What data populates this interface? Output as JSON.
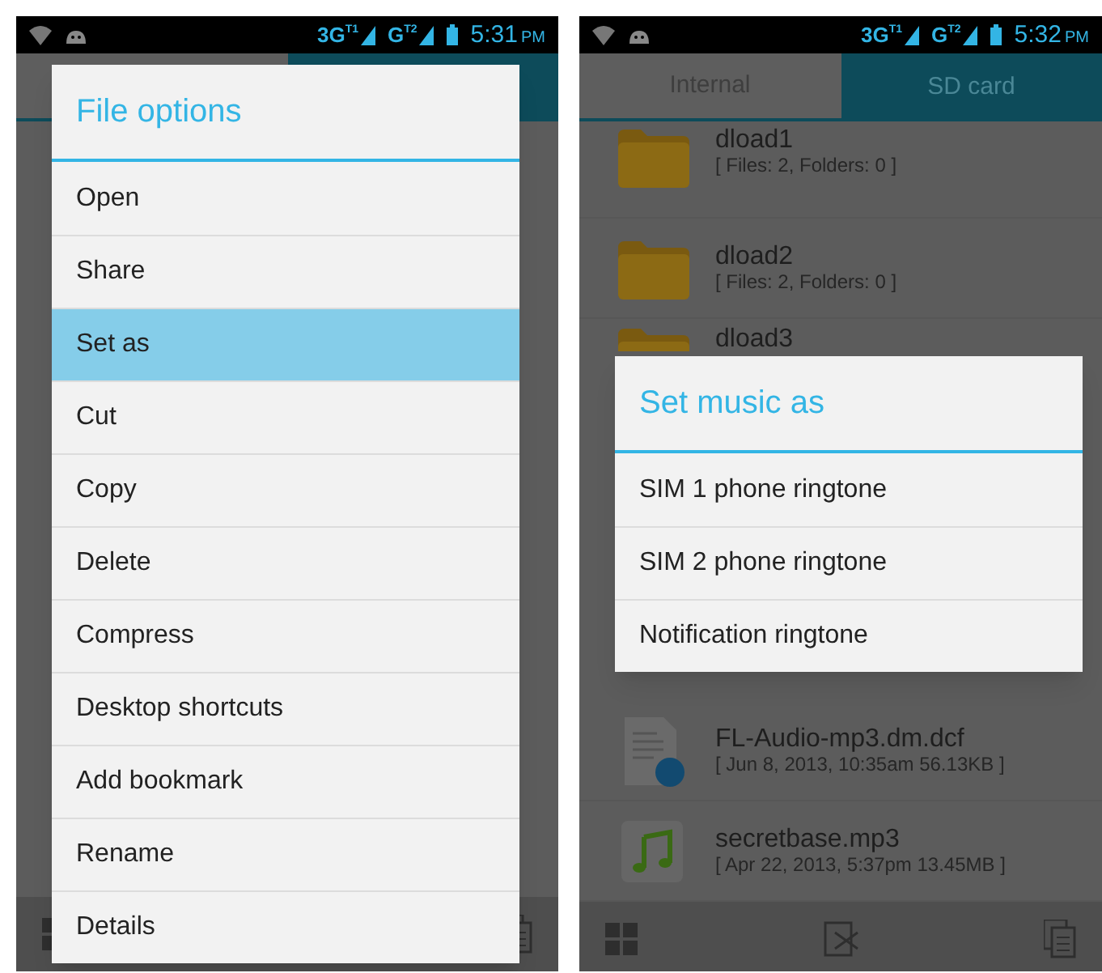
{
  "screens": [
    {
      "status_bar": {
        "network_1": "3G",
        "sim_1": "T1",
        "network_2": "G",
        "sim_2": "T2",
        "time": "5:31",
        "meridiem": "PM"
      },
      "tabs": [
        {
          "selected": false
        },
        {
          "selected": true
        }
      ],
      "dialog": {
        "title": "File options",
        "items": [
          {
            "label": "Open",
            "selected": false
          },
          {
            "label": "Share",
            "selected": false
          },
          {
            "label": "Set as",
            "selected": true
          },
          {
            "label": "Cut",
            "selected": false
          },
          {
            "label": "Copy",
            "selected": false
          },
          {
            "label": "Delete",
            "selected": false
          },
          {
            "label": "Compress",
            "selected": false
          },
          {
            "label": "Desktop shortcuts",
            "selected": false
          },
          {
            "label": "Add bookmark",
            "selected": false
          },
          {
            "label": "Rename",
            "selected": false
          },
          {
            "label": "Details",
            "selected": false
          }
        ]
      }
    },
    {
      "status_bar": {
        "network_1": "3G",
        "sim_1": "T1",
        "network_2": "G",
        "sim_2": "T2",
        "time": "5:32",
        "meridiem": "PM"
      },
      "tabs": [
        {
          "label": "Internal",
          "selected": false
        },
        {
          "label": "SD card",
          "selected": true
        }
      ],
      "files_above": [
        {
          "kind": "folder",
          "name": "dload1",
          "details": "[ Files: 2, Folders: 0 ]"
        },
        {
          "kind": "folder",
          "name": "dload2",
          "details": "[ Files: 2, Folders: 0 ]"
        },
        {
          "kind": "folder",
          "name": "dload3"
        }
      ],
      "files_below": [
        {
          "kind": "document",
          "name": "FL-Audio-mp3.dm.dcf",
          "details": "[ Jun 8, 2013, 10:35am 56.13KB ]"
        },
        {
          "kind": "audio",
          "name": "secretbase.mp3",
          "details": "[ Apr 22, 2013, 5:37pm 13.45MB ]"
        }
      ],
      "dialog": {
        "title": "Set music as",
        "items": [
          {
            "label": "SIM 1 phone ringtone",
            "selected": false
          },
          {
            "label": "SIM 2 phone ringtone",
            "selected": false
          },
          {
            "label": "Notification ringtone",
            "selected": false
          }
        ]
      }
    }
  ]
}
